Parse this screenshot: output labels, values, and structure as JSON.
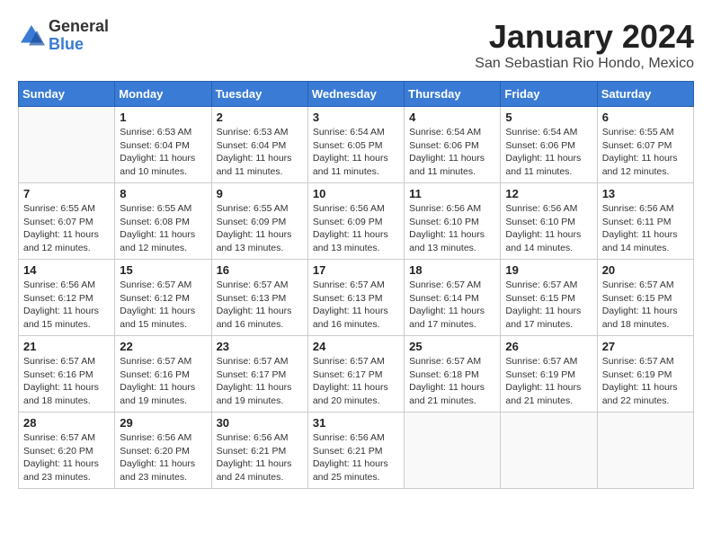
{
  "logo": {
    "general": "General",
    "blue": "Blue"
  },
  "title": "January 2024",
  "subtitle": "San Sebastian Rio Hondo, Mexico",
  "days_of_week": [
    "Sunday",
    "Monday",
    "Tuesday",
    "Wednesday",
    "Thursday",
    "Friday",
    "Saturday"
  ],
  "weeks": [
    [
      {
        "day": "",
        "info": ""
      },
      {
        "day": "1",
        "info": "Sunrise: 6:53 AM\nSunset: 6:04 PM\nDaylight: 11 hours\nand 10 minutes."
      },
      {
        "day": "2",
        "info": "Sunrise: 6:53 AM\nSunset: 6:04 PM\nDaylight: 11 hours\nand 11 minutes."
      },
      {
        "day": "3",
        "info": "Sunrise: 6:54 AM\nSunset: 6:05 PM\nDaylight: 11 hours\nand 11 minutes."
      },
      {
        "day": "4",
        "info": "Sunrise: 6:54 AM\nSunset: 6:06 PM\nDaylight: 11 hours\nand 11 minutes."
      },
      {
        "day": "5",
        "info": "Sunrise: 6:54 AM\nSunset: 6:06 PM\nDaylight: 11 hours\nand 11 minutes."
      },
      {
        "day": "6",
        "info": "Sunrise: 6:55 AM\nSunset: 6:07 PM\nDaylight: 11 hours\nand 12 minutes."
      }
    ],
    [
      {
        "day": "7",
        "info": "Sunrise: 6:55 AM\nSunset: 6:07 PM\nDaylight: 11 hours\nand 12 minutes."
      },
      {
        "day": "8",
        "info": "Sunrise: 6:55 AM\nSunset: 6:08 PM\nDaylight: 11 hours\nand 12 minutes."
      },
      {
        "day": "9",
        "info": "Sunrise: 6:55 AM\nSunset: 6:09 PM\nDaylight: 11 hours\nand 13 minutes."
      },
      {
        "day": "10",
        "info": "Sunrise: 6:56 AM\nSunset: 6:09 PM\nDaylight: 11 hours\nand 13 minutes."
      },
      {
        "day": "11",
        "info": "Sunrise: 6:56 AM\nSunset: 6:10 PM\nDaylight: 11 hours\nand 13 minutes."
      },
      {
        "day": "12",
        "info": "Sunrise: 6:56 AM\nSunset: 6:10 PM\nDaylight: 11 hours\nand 14 minutes."
      },
      {
        "day": "13",
        "info": "Sunrise: 6:56 AM\nSunset: 6:11 PM\nDaylight: 11 hours\nand 14 minutes."
      }
    ],
    [
      {
        "day": "14",
        "info": "Sunrise: 6:56 AM\nSunset: 6:12 PM\nDaylight: 11 hours\nand 15 minutes."
      },
      {
        "day": "15",
        "info": "Sunrise: 6:57 AM\nSunset: 6:12 PM\nDaylight: 11 hours\nand 15 minutes."
      },
      {
        "day": "16",
        "info": "Sunrise: 6:57 AM\nSunset: 6:13 PM\nDaylight: 11 hours\nand 16 minutes."
      },
      {
        "day": "17",
        "info": "Sunrise: 6:57 AM\nSunset: 6:13 PM\nDaylight: 11 hours\nand 16 minutes."
      },
      {
        "day": "18",
        "info": "Sunrise: 6:57 AM\nSunset: 6:14 PM\nDaylight: 11 hours\nand 17 minutes."
      },
      {
        "day": "19",
        "info": "Sunrise: 6:57 AM\nSunset: 6:15 PM\nDaylight: 11 hours\nand 17 minutes."
      },
      {
        "day": "20",
        "info": "Sunrise: 6:57 AM\nSunset: 6:15 PM\nDaylight: 11 hours\nand 18 minutes."
      }
    ],
    [
      {
        "day": "21",
        "info": "Sunrise: 6:57 AM\nSunset: 6:16 PM\nDaylight: 11 hours\nand 18 minutes."
      },
      {
        "day": "22",
        "info": "Sunrise: 6:57 AM\nSunset: 6:16 PM\nDaylight: 11 hours\nand 19 minutes."
      },
      {
        "day": "23",
        "info": "Sunrise: 6:57 AM\nSunset: 6:17 PM\nDaylight: 11 hours\nand 19 minutes."
      },
      {
        "day": "24",
        "info": "Sunrise: 6:57 AM\nSunset: 6:17 PM\nDaylight: 11 hours\nand 20 minutes."
      },
      {
        "day": "25",
        "info": "Sunrise: 6:57 AM\nSunset: 6:18 PM\nDaylight: 11 hours\nand 21 minutes."
      },
      {
        "day": "26",
        "info": "Sunrise: 6:57 AM\nSunset: 6:19 PM\nDaylight: 11 hours\nand 21 minutes."
      },
      {
        "day": "27",
        "info": "Sunrise: 6:57 AM\nSunset: 6:19 PM\nDaylight: 11 hours\nand 22 minutes."
      }
    ],
    [
      {
        "day": "28",
        "info": "Sunrise: 6:57 AM\nSunset: 6:20 PM\nDaylight: 11 hours\nand 23 minutes."
      },
      {
        "day": "29",
        "info": "Sunrise: 6:56 AM\nSunset: 6:20 PM\nDaylight: 11 hours\nand 23 minutes."
      },
      {
        "day": "30",
        "info": "Sunrise: 6:56 AM\nSunset: 6:21 PM\nDaylight: 11 hours\nand 24 minutes."
      },
      {
        "day": "31",
        "info": "Sunrise: 6:56 AM\nSunset: 6:21 PM\nDaylight: 11 hours\nand 25 minutes."
      },
      {
        "day": "",
        "info": ""
      },
      {
        "day": "",
        "info": ""
      },
      {
        "day": "",
        "info": ""
      }
    ]
  ]
}
